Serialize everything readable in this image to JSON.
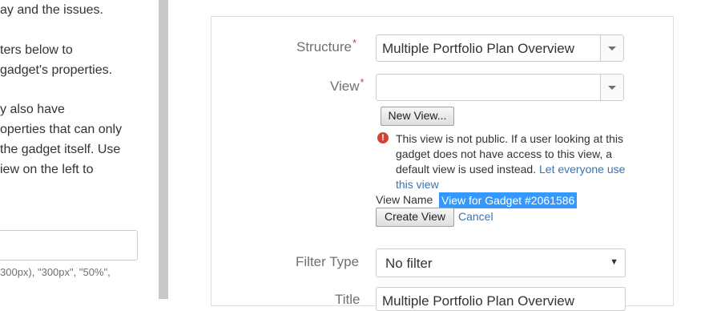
{
  "left_panel": {
    "lines": [
      "ay and the issues.",
      "ters below to",
      "gadget's properties.",
      "y also have",
      "operties that can only",
      " the gadget itself. Use",
      "iew on the left to"
    ],
    "hint": "300px), \"300px\", \"50%\","
  },
  "form": {
    "structure_label": "Structure",
    "structure_value": "Multiple Portfolio Plan Overview",
    "view_label": "View",
    "view_value": "",
    "new_view_button": "New View...",
    "warning_text": "This view is not public. If a user looking at this gadget does not have access to this view, a default view is used instead.",
    "warning_link": "Let everyone use this view",
    "view_name_label": "View Name",
    "view_name_value": "View for Gadget #2061586",
    "create_view_button": "Create View",
    "cancel_link": "Cancel",
    "filter_type_label": "Filter Type",
    "filter_type_value": "No filter",
    "title_label": "Title",
    "title_value": "Multiple Portfolio Plan Overview"
  },
  "colors": {
    "required_marker": "#d04437",
    "link": "#3b73af",
    "selection": "#3399ff"
  }
}
